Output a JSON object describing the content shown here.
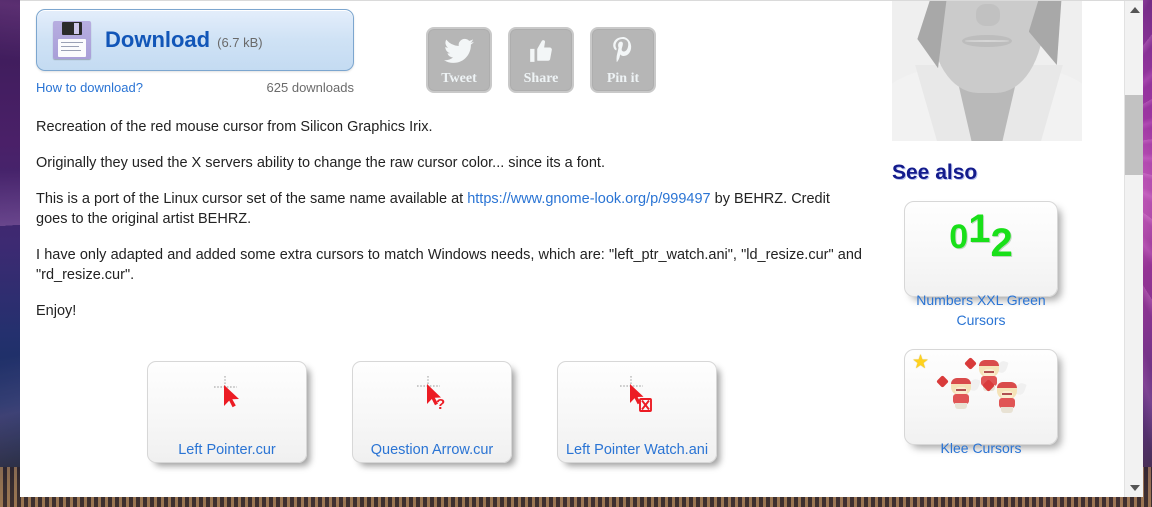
{
  "download": {
    "icon": "floppy-disk-icon",
    "label": "Download",
    "size": "(6.7 kB)",
    "how_to_link": "How to download?",
    "downloads_count": "625 downloads"
  },
  "social": {
    "buttons": [
      {
        "label": "Tweet",
        "icon": "twitter-bird-icon"
      },
      {
        "label": "Share",
        "icon": "thumbs-up-icon"
      },
      {
        "label": "Pin it",
        "icon": "pinterest-p-icon"
      }
    ]
  },
  "description": {
    "p1": "Recreation of the red mouse cursor from Silicon Graphics Irix.",
    "p2": "Originally they used the X servers ability to change the raw cursor color... since its a font.",
    "p3_before": "This is a port of the Linux cursor set of the same name available at ",
    "p3_link": "https://www.gnome-look.org/p/999497",
    "p3_after": " by BEHRZ. Credit goes to the original artist BEHRZ.",
    "p4": "I have only adapted and added some extra cursors to match Windows needs, which are: \"left_ptr_watch.ani\", \"ld_resize.cur\" and \"rd_resize.cur\".",
    "p5": "Enjoy!"
  },
  "previews": [
    {
      "caption": "Left Pointer.cur",
      "icon": "red-arrow-cursor-icon"
    },
    {
      "caption": "Question Arrow.cur",
      "icon": "red-arrow-question-cursor-icon"
    },
    {
      "caption": "Left Pointer Watch.ani",
      "icon": "red-arrow-hourglass-cursor-icon"
    }
  ],
  "sidebar": {
    "profile_image": "grayscale-portrait-avatar",
    "see_also_heading": "See also",
    "cards": [
      {
        "caption": "Numbers XXL Green Cursors",
        "art": "green-numbers-icon",
        "digits": [
          "0",
          "1",
          "2"
        ],
        "starred": false,
        "accent": "#19e019"
      },
      {
        "caption": "Klee Cursors",
        "art": "klee-character-sprites-icon",
        "starred": true,
        "star_icon": "star-icon",
        "accent": "#e05555"
      }
    ]
  },
  "scrollbar": {
    "up_icon": "triangle-up-icon",
    "down_icon": "triangle-down-icon",
    "thumb": "scroll-thumb"
  },
  "colors": {
    "link": "#2a74d4",
    "download_label": "#1256b8",
    "heading": "#131b8c",
    "page_bg": "#ffffff"
  }
}
